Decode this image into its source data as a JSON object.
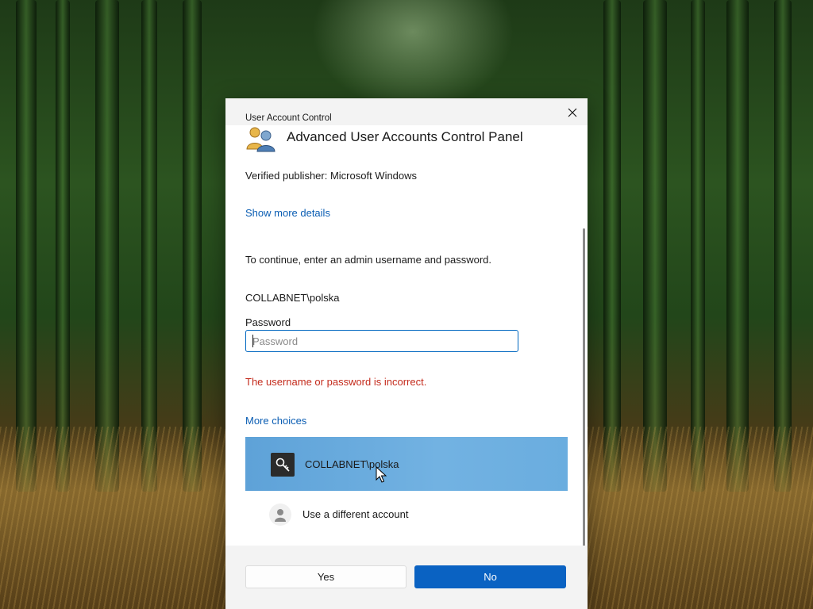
{
  "window": {
    "title": "User Account Control",
    "close_icon": "close-icon"
  },
  "app": {
    "name": "Advanced User Accounts Control Panel",
    "icon": "user-accounts-icon"
  },
  "publisher": "Verified publisher: Microsoft Windows",
  "show_details_link": "Show more details",
  "instruction": "To continue, enter an admin username and password.",
  "username": "COLLABNET\\polska",
  "password": {
    "label": "Password",
    "placeholder": "Password",
    "value": ""
  },
  "error_message": "The username or password is incorrect.",
  "more_choices_link": "More choices",
  "accounts": [
    {
      "label": "COLLABNET\\polska",
      "icon": "key-icon",
      "selected": true
    },
    {
      "label": "Use a different account",
      "icon": "person-icon",
      "selected": false
    }
  ],
  "buttons": {
    "yes": "Yes",
    "no": "No"
  },
  "colors": {
    "accent": "#0a62c2",
    "link": "#0a5db3",
    "error": "#c42b1c",
    "selection": "#6aaddf"
  }
}
